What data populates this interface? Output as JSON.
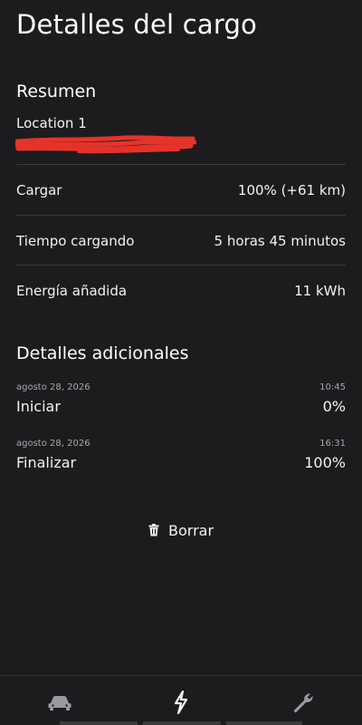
{
  "header": {
    "title": "Detalles del cargo"
  },
  "summary": {
    "title": "Resumen",
    "location": "Location 1",
    "address_redacted": true,
    "rows": [
      {
        "label": "Cargar",
        "value": "100% (+61 km)"
      },
      {
        "label": "Tiempo cargando",
        "value": "5 horas 45 minutos"
      },
      {
        "label": "Energía añadida",
        "value": "11 kWh"
      }
    ]
  },
  "additional": {
    "title": "Detalles adicionales",
    "events": [
      {
        "date": "agosto 28, 2026",
        "time": "10:45",
        "label": "Iniciar",
        "value": "0%"
      },
      {
        "date": "agosto 28, 2026",
        "time": "16:31",
        "label": "Finalizar",
        "value": "100%"
      }
    ]
  },
  "actions": {
    "delete_label": "Borrar"
  },
  "nav": {
    "items": [
      {
        "icon": "car-icon",
        "active": false
      },
      {
        "icon": "charging-bolt-icon",
        "active": true
      },
      {
        "icon": "wrench-icon",
        "active": false
      }
    ]
  },
  "colors": {
    "background": "#1c1c1e",
    "text": "#ffffff",
    "divider": "#3a3a3c",
    "muted": "#a8a8ad",
    "redaction": "#e5332a"
  }
}
